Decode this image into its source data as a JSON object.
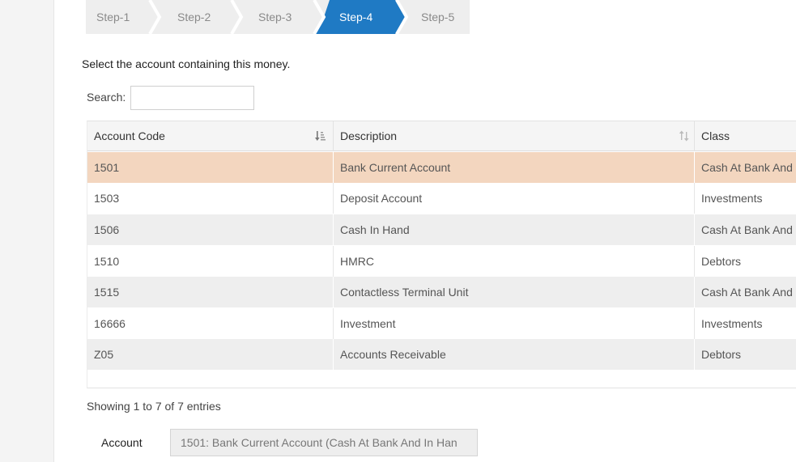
{
  "stepper": {
    "steps": [
      {
        "label": "Step-1",
        "active": false
      },
      {
        "label": "Step-2",
        "active": false
      },
      {
        "label": "Step-3",
        "active": false
      },
      {
        "label": "Step-4",
        "active": true
      },
      {
        "label": "Step-5",
        "active": false
      }
    ],
    "active_color": "#1f7ac4",
    "inactive_color": "#eeeeee"
  },
  "intro_text": "Select the account containing this money.",
  "search": {
    "label": "Search:",
    "value": ""
  },
  "table": {
    "columns": [
      "Account Code",
      "Description",
      "Class"
    ],
    "rows": [
      {
        "code": "1501",
        "description": "Bank Current Account",
        "class": "Cash At Bank And",
        "selected": true
      },
      {
        "code": "1503",
        "description": "Deposit Account",
        "class": "Investments",
        "selected": false
      },
      {
        "code": "1506",
        "description": "Cash In Hand",
        "class": "Cash At Bank And",
        "selected": false
      },
      {
        "code": "1510",
        "description": "HMRC",
        "class": "Debtors",
        "selected": false
      },
      {
        "code": "1515",
        "description": "Contactless Terminal Unit",
        "class": "Cash At Bank And",
        "selected": false
      },
      {
        "code": "16666",
        "description": "Investment",
        "class": "Investments",
        "selected": false
      },
      {
        "code": "Z05",
        "description": "Accounts Receivable",
        "class": "Debtors",
        "selected": false
      }
    ],
    "selected_color": "#f3d6bf"
  },
  "info_text": "Showing 1 to 7 of 7 entries",
  "account": {
    "label": "Account",
    "value": "1501: Bank Current Account (Cash At Bank And In Han"
  }
}
